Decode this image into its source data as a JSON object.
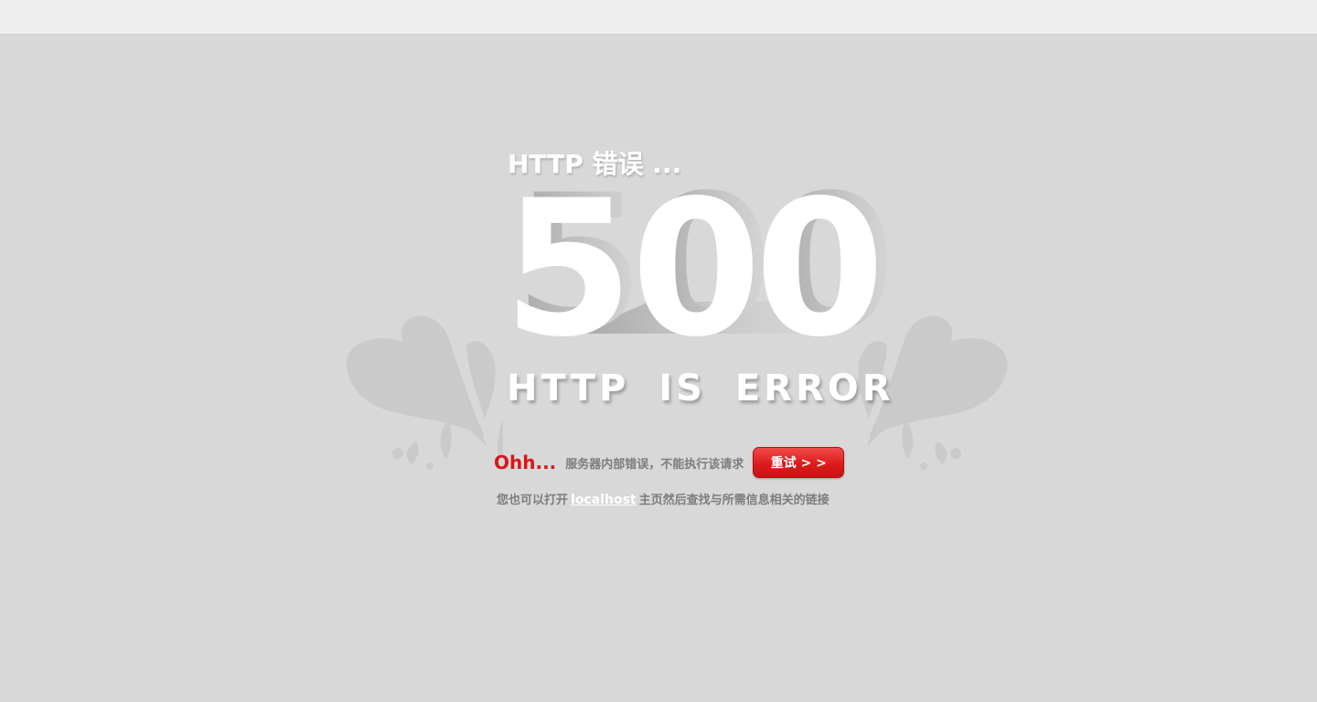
{
  "page": {
    "headline": "HTTP 错误 ...",
    "code_digits": [
      "5",
      "0",
      "0"
    ],
    "subtitle": "HTTP IS ERROR",
    "ohh": "Ohh...",
    "message": "服务器内部错误，不能执行该请求",
    "retry_label": "重试 > >",
    "hint_prefix": "您也可以打开",
    "hint_link": "localhost",
    "hint_suffix": "主页然后查找与所需信息相关的链接"
  },
  "colors": {
    "background": "#d8d8d8",
    "topbar": "#eeeeee",
    "accent_red": "#d9161a",
    "text_gray": "#7d7d7d",
    "white": "#ffffff"
  },
  "icons": {
    "decoration": "floral-splash-decoration"
  }
}
